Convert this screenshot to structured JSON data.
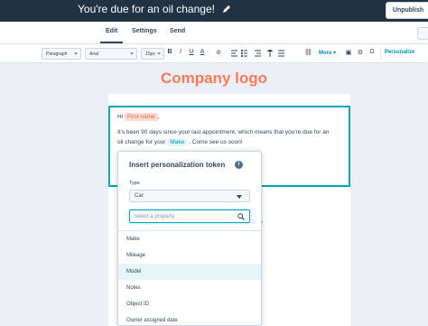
{
  "header": {
    "title": "You're due for an oil change!",
    "edit_icon": "pencil-icon",
    "unpublish_label": "Unpublish"
  },
  "tabs": [
    {
      "label": "Edit",
      "active": true
    },
    {
      "label": "Settings",
      "active": false
    },
    {
      "label": "Send",
      "active": false
    }
  ],
  "toolbar": {
    "paragraph": "Paragraph",
    "font": "Arial",
    "size": "15px",
    "buttons": [
      "B",
      "I",
      "U",
      "A",
      "⊘"
    ],
    "more_label": "More",
    "personalize_label": "Personalize"
  },
  "email": {
    "logo_text": "Company logo",
    "greeting_prefix": "Hi",
    "greeting_token": "First name",
    "greeting_suffix": ",",
    "body_line1": "It's been 90 days since your last appointment, which means that you're due for an",
    "body_line2_prefix": "oil change for your",
    "body_token": "Make",
    "body_line2_suffix": ". Come see us soon!"
  },
  "popover": {
    "title": "Insert personalization token",
    "type_label": "Type",
    "type_value": "Car",
    "search_placeholder": "Select a property",
    "options": [
      "Make",
      "Mileage",
      "Model",
      "Notes",
      "Object ID",
      "Owner assigned date"
    ],
    "hovered_option": "Model"
  },
  "colors": {
    "topbar": "#213343",
    "accent": "#00a4bd",
    "logo": "#ff7a59"
  }
}
